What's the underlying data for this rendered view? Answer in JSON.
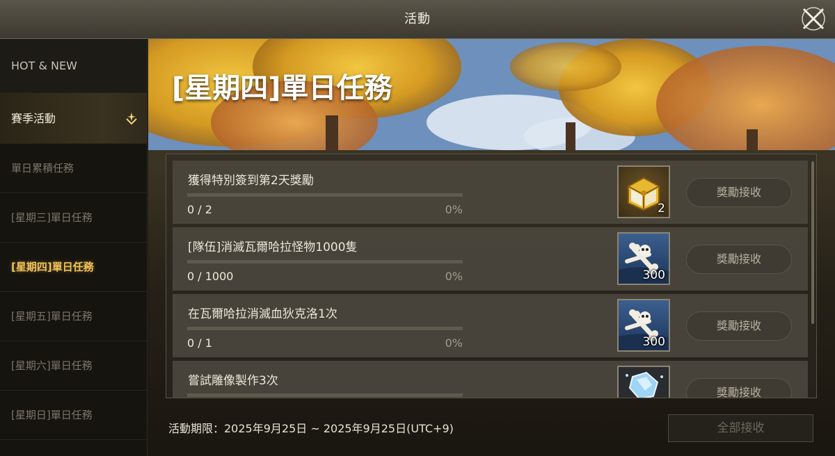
{
  "window": {
    "title": "活動"
  },
  "sidebar": {
    "items": [
      {
        "label": "HOT & NEW"
      },
      {
        "label": "賽季活動"
      },
      {
        "label": "單日累積任務"
      },
      {
        "label": "[星期三]單日任務"
      },
      {
        "label": "[星期四]單日任務"
      },
      {
        "label": "[星期五]單日任務"
      },
      {
        "label": "[星期六]單日任務"
      },
      {
        "label": "[星期日]單日任務"
      }
    ],
    "active_index": 4
  },
  "main": {
    "title": "[星期四]單日任務",
    "missions": [
      {
        "name": "獲得特別簽到第2天獎勵",
        "count": "0 / 2",
        "percent": "0%",
        "progress": 0,
        "reward_icon": "gold-chest-icon",
        "reward_qty": "2",
        "button": "獎勵接收"
      },
      {
        "name": "[隊伍]消滅瓦爾哈拉怪物1000隻",
        "count": "0 / 1000",
        "percent": "0%",
        "progress": 0,
        "reward_icon": "bone-icon",
        "reward_qty": "300",
        "button": "獎勵接收"
      },
      {
        "name": "在瓦爾哈拉消滅血狄克洛1次",
        "count": "0 / 1",
        "percent": "0%",
        "progress": 0,
        "reward_icon": "bone-icon",
        "reward_qty": "300",
        "button": "獎勵接收"
      },
      {
        "name": "嘗試雕像製作3次",
        "count": "",
        "percent": "",
        "progress": 0,
        "reward_icon": "crystal-icon",
        "reward_qty": "",
        "button": "獎勵接收"
      }
    ],
    "period": "活動期限：2025年9月25日 ~ 2025年9月25日(UTC+9)",
    "claim_all": "全部接收"
  },
  "colors": {
    "accent": "#f3c257",
    "panel": "#4a463c",
    "title_bar": "#4a463c"
  }
}
